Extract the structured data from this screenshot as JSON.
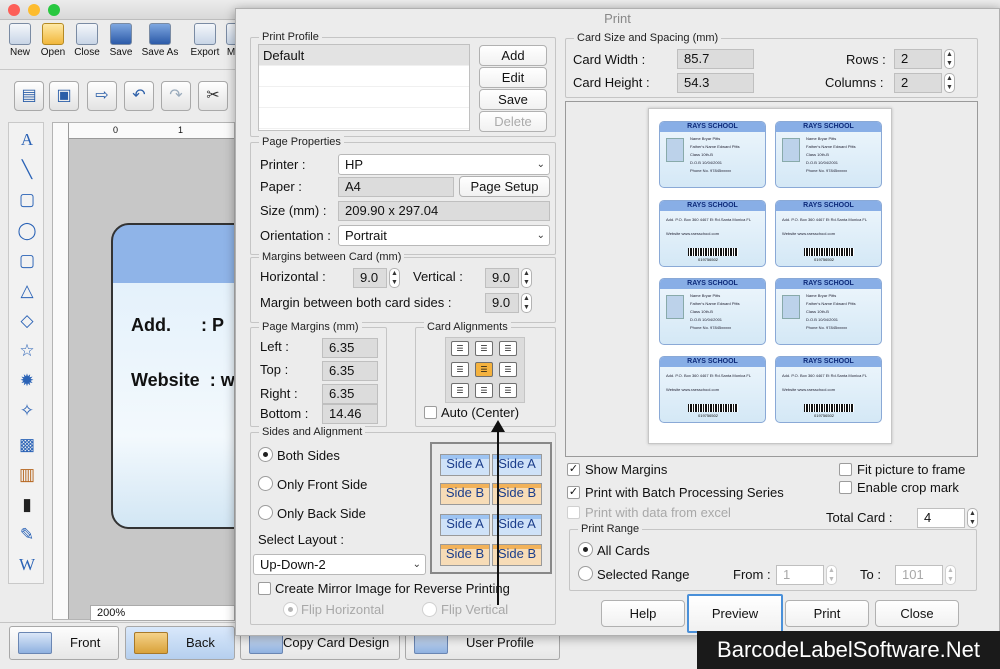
{
  "app": {
    "title": "DRPU Business ID Card Maker",
    "toolbar": [
      "New",
      "Open",
      "Close",
      "Save",
      "Save As",
      "Export",
      "M"
    ],
    "zoom": "200%",
    "card_preview": {
      "add_label": "Add.",
      "add_value": ": P",
      "website_label": "Website",
      "website_value": ": w"
    },
    "tabs": {
      "front": "Front",
      "back": "Back",
      "copy": "Copy Card Design",
      "profile": "User Profile"
    }
  },
  "dialog": {
    "title": "Print",
    "print_profile": {
      "legend": "Print Profile",
      "items": [
        "Default"
      ],
      "add": "Add",
      "edit": "Edit",
      "save": "Save",
      "delete": "Delete"
    },
    "page_properties": {
      "legend": "Page Properties",
      "printer_label": "Printer :",
      "printer_value": "HP",
      "paper_label": "Paper :",
      "paper_value": "A4",
      "page_setup": "Page Setup",
      "size_label": "Size (mm) :",
      "size_value": "209.90 x 297.04",
      "orientation_label": "Orientation :",
      "orientation_value": "Portrait"
    },
    "margins_between": {
      "legend": "Margins between Card (mm)",
      "horizontal_label": "Horizontal :",
      "horizontal_value": "9.0",
      "vertical_label": "Vertical :",
      "vertical_value": "9.0",
      "both_label": "Margin between both card sides :",
      "both_value": "9.0"
    },
    "page_margins": {
      "legend": "Page Margins (mm)",
      "left_label": "Left :",
      "left_value": "6.35",
      "top_label": "Top :",
      "top_value": "6.35",
      "right_label": "Right :",
      "right_value": "6.35",
      "bottom_label": "Bottom :",
      "bottom_value": "14.46"
    },
    "card_alignments": {
      "legend": "Card Alignments",
      "auto_center": "Auto (Center)"
    },
    "sides": {
      "legend": "Sides and Alignment",
      "both": "Both Sides",
      "front_only": "Only Front Side",
      "back_only": "Only Back Side",
      "select_layout_label": "Select Layout :",
      "layout_value": "Up-Down-2",
      "side_a": "Side A",
      "side_b": "Side B",
      "mirror": "Create Mirror Image for Reverse Printing",
      "flip_h": "Flip Horizontal",
      "flip_v": "Flip Vertical"
    },
    "card_size": {
      "legend": "Card Size and Spacing (mm)",
      "width_label": "Card Width :",
      "width_value": "85.7",
      "height_label": "Card Height :",
      "height_value": "54.3",
      "rows_label": "Rows :",
      "rows_value": "2",
      "columns_label": "Columns :",
      "columns_value": "2"
    },
    "mini_card": {
      "school": "RAYS SCHOOL",
      "front_fields": [
        "Name",
        "Father's Name",
        "Class",
        "D.O.B",
        "Phone No."
      ],
      "front_values": [
        "Bryar Pitts",
        "Edward Pitts",
        "10th-B",
        "10/04/2001",
        "97845xxxxx"
      ],
      "back_add": "Add.",
      "back_add_value": "P.O. Box 360 4467 Et Rd.Santa Monica FL",
      "back_website": "Website",
      "back_website_value": "www.raesschool.com",
      "barcode_no": "019756502"
    },
    "options": {
      "show_margins": "Show Margins",
      "batch": "Print with Batch Processing Series",
      "print_data": "Print with data from excel",
      "fit_picture": "Fit picture to frame",
      "crop_mark": "Enable crop mark",
      "total_card_label": "Total Card :",
      "total_card_value": "4"
    },
    "print_range": {
      "legend": "Print Range",
      "all": "All Cards",
      "selected": "Selected Range",
      "from_label": "From :",
      "from_value": "1",
      "to_label": "To :",
      "to_value": "101"
    },
    "buttons": {
      "help": "Help",
      "preview": "Preview",
      "print": "Print",
      "close": "Close"
    }
  },
  "watermark": "BarcodeLabelSoftware.Net",
  "colors": {
    "accent": "#4a90d9",
    "card_header": "#88aee6",
    "selected_align": "#f4b23e"
  }
}
